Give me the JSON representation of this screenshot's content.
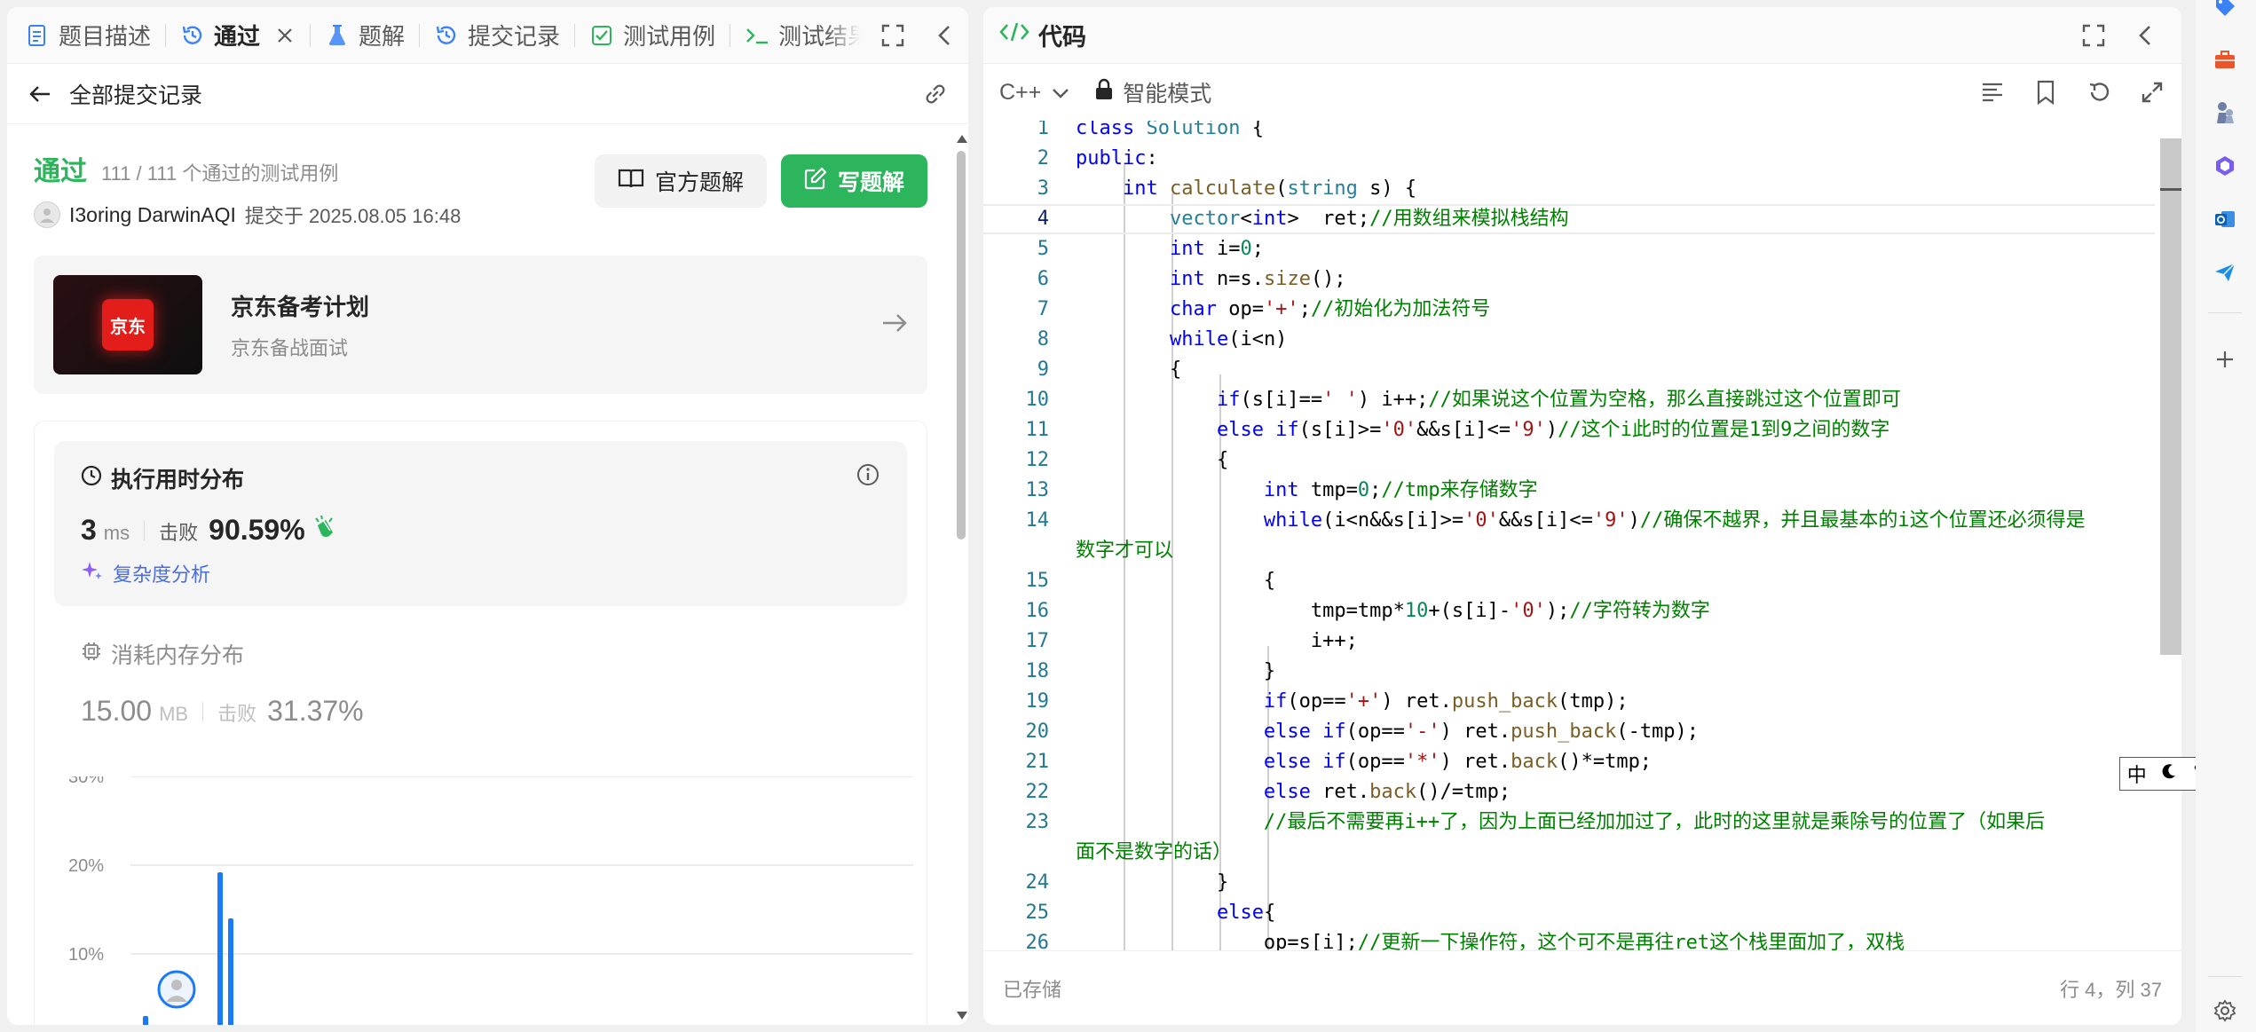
{
  "left_tabs": [
    {
      "label": "题目描述",
      "icon": "document-icon"
    },
    {
      "label": "通过",
      "icon": "history-icon",
      "active": true
    },
    {
      "label": "题解",
      "icon": "flask-icon"
    },
    {
      "label": "提交记录",
      "icon": "history-icon"
    },
    {
      "label": "测试用例",
      "icon": "checkbox-icon"
    },
    {
      "label": "测试结果",
      "icon": "terminal-icon"
    }
  ],
  "subheader": {
    "back_label": "全部提交记录"
  },
  "result": {
    "status": "通过",
    "count": "111 / 111 个通过的测试用例",
    "author": "I3oring DarwinAQI",
    "submitted": "提交于 2025.08.05 16:48",
    "official_label": "官方题解",
    "write_label": "写题解"
  },
  "promo": {
    "logo_text": "京东",
    "title": "京东备考计划",
    "subtitle": "京东备战面试"
  },
  "runtime": {
    "title": "执行用时分布",
    "value": "3",
    "unit": "ms",
    "beat_label": "击败",
    "beat": "90.59%",
    "complexity_label": "复杂度分析"
  },
  "memory": {
    "title": "消耗内存分布",
    "value": "15.00",
    "unit": "MB",
    "beat_label": "击败",
    "beat": "31.37%"
  },
  "chart_data": {
    "type": "bar",
    "y_ticks": [
      "30%",
      "20%",
      "10%"
    ],
    "ylim": [
      0,
      30
    ],
    "visible_bars": [
      {
        "value": 3
      },
      {
        "value": 19.2
      },
      {
        "value": 14
      }
    ]
  },
  "code_panel": {
    "title": "代码",
    "language": "C++",
    "mode": "智能模式",
    "save_status": "已存储",
    "cursor_pos": "行 4，列 37"
  },
  "ime": {
    "lang": "中"
  },
  "colors": {
    "accent_green": "#2db55d",
    "link_blue": "#4a6ee0",
    "bar_blue": "#1a7af8"
  }
}
